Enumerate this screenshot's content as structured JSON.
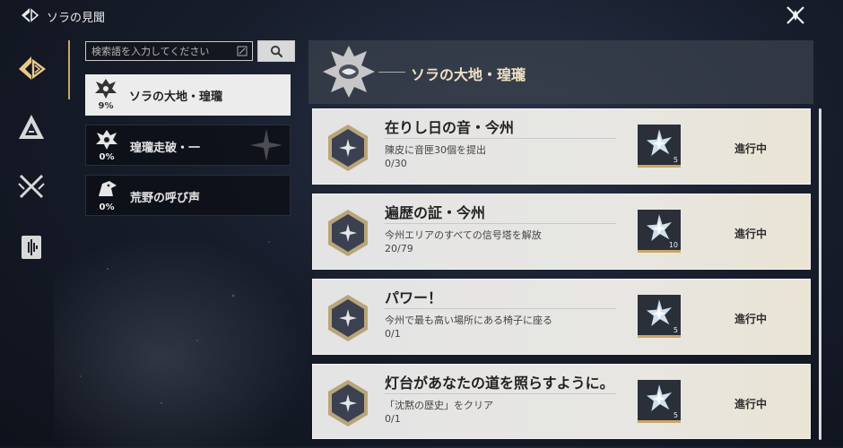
{
  "app": {
    "title": "ソラの見聞"
  },
  "search": {
    "placeholder": "検索語を入力してください"
  },
  "nav": [
    {
      "name": "sola-emblem-icon"
    },
    {
      "name": "mountain-triangle-icon"
    },
    {
      "name": "crossed-swords-icon"
    },
    {
      "name": "soundwave-card-icon"
    }
  ],
  "categories": [
    {
      "label": "ソラの大地・瑝瓏",
      "percent": "9%",
      "active": true
    },
    {
      "label": "瑝瓏走破・一",
      "percent": "0%",
      "active": false
    },
    {
      "label": "荒野の呼び声",
      "percent": "0%",
      "active": false
    }
  ],
  "panel": {
    "title": "ソラの大地・瑝瓏"
  },
  "achievements": [
    {
      "title": "在りし日の音・今州",
      "description": "陳皮に音匣30個を提出",
      "progress": "0/30",
      "reward_count": "5",
      "status": "進行中"
    },
    {
      "title": "遍歴の証・今州",
      "description": "今州エリアのすべての信号塔を解放",
      "progress": "20/79",
      "reward_count": "10",
      "status": "進行中"
    },
    {
      "title": "パワー！",
      "description": "今州で最も高い場所にある椅子に座る",
      "progress": "0/1",
      "reward_count": "5",
      "status": "進行中"
    },
    {
      "title": "灯台があなたの道を照らすように。",
      "description": "「沈黙の歴史」をクリア",
      "progress": "0/1",
      "reward_count": "5",
      "status": "進行中"
    }
  ],
  "colors": {
    "accent_gold": "#c9a567",
    "active_category_bg": "#ececec",
    "card_bg": "#e4e4e4"
  }
}
